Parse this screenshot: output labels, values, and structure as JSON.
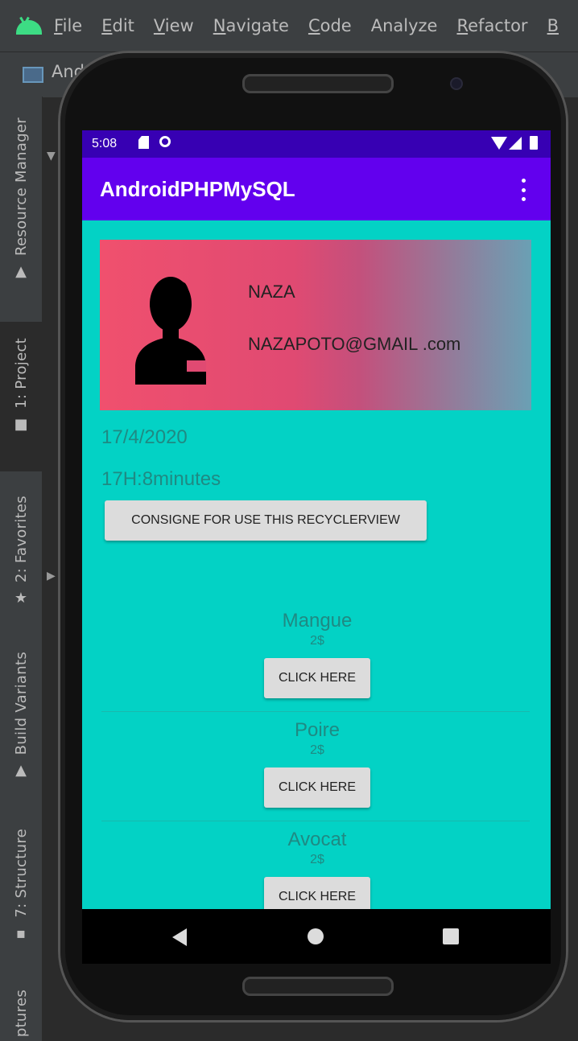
{
  "ide": {
    "menu": [
      {
        "mnemonic": "F",
        "rest": "ile"
      },
      {
        "mnemonic": "E",
        "rest": "dit"
      },
      {
        "mnemonic": "V",
        "rest": "iew"
      },
      {
        "mnemonic": "N",
        "rest": "avigate"
      },
      {
        "mnemonic": "C",
        "rest": "ode"
      },
      {
        "mnemonic": "",
        "rest": "Analyze"
      },
      {
        "mnemonic": "R",
        "rest": "efactor"
      },
      {
        "mnemonic": "B",
        "rest": ""
      }
    ],
    "project_label": "And",
    "side_tabs": {
      "resource_manager": "Resource Manager",
      "project": "1: Project",
      "favorites": "2: Favorites",
      "build_variants": "Build Variants",
      "structure": "7: Structure",
      "captures": "ptures"
    }
  },
  "status_bar": {
    "time": "5:08"
  },
  "app_bar": {
    "title": "AndroidPHPMySQL"
  },
  "profile": {
    "name": "NAZA",
    "email": "NAZAPOTO@GMAIL .com"
  },
  "date": "17/4/2020",
  "time": "17H:8minutes",
  "consigne_button": "CONSIGNE FOR USE THIS RECYCLERVIEW",
  "products": [
    {
      "name": "Mangue",
      "price": "2$",
      "button": "CLICK HERE"
    },
    {
      "name": "Poire",
      "price": "2$",
      "button": "CLICK HERE"
    },
    {
      "name": "Avocat",
      "price": "2$",
      "button": "CLICK HERE"
    }
  ],
  "colors": {
    "status_bar": "#3700b3",
    "app_bar": "#6200ee",
    "screen_bg": "#03d2c5",
    "ide_bg": "#3c3f41"
  }
}
